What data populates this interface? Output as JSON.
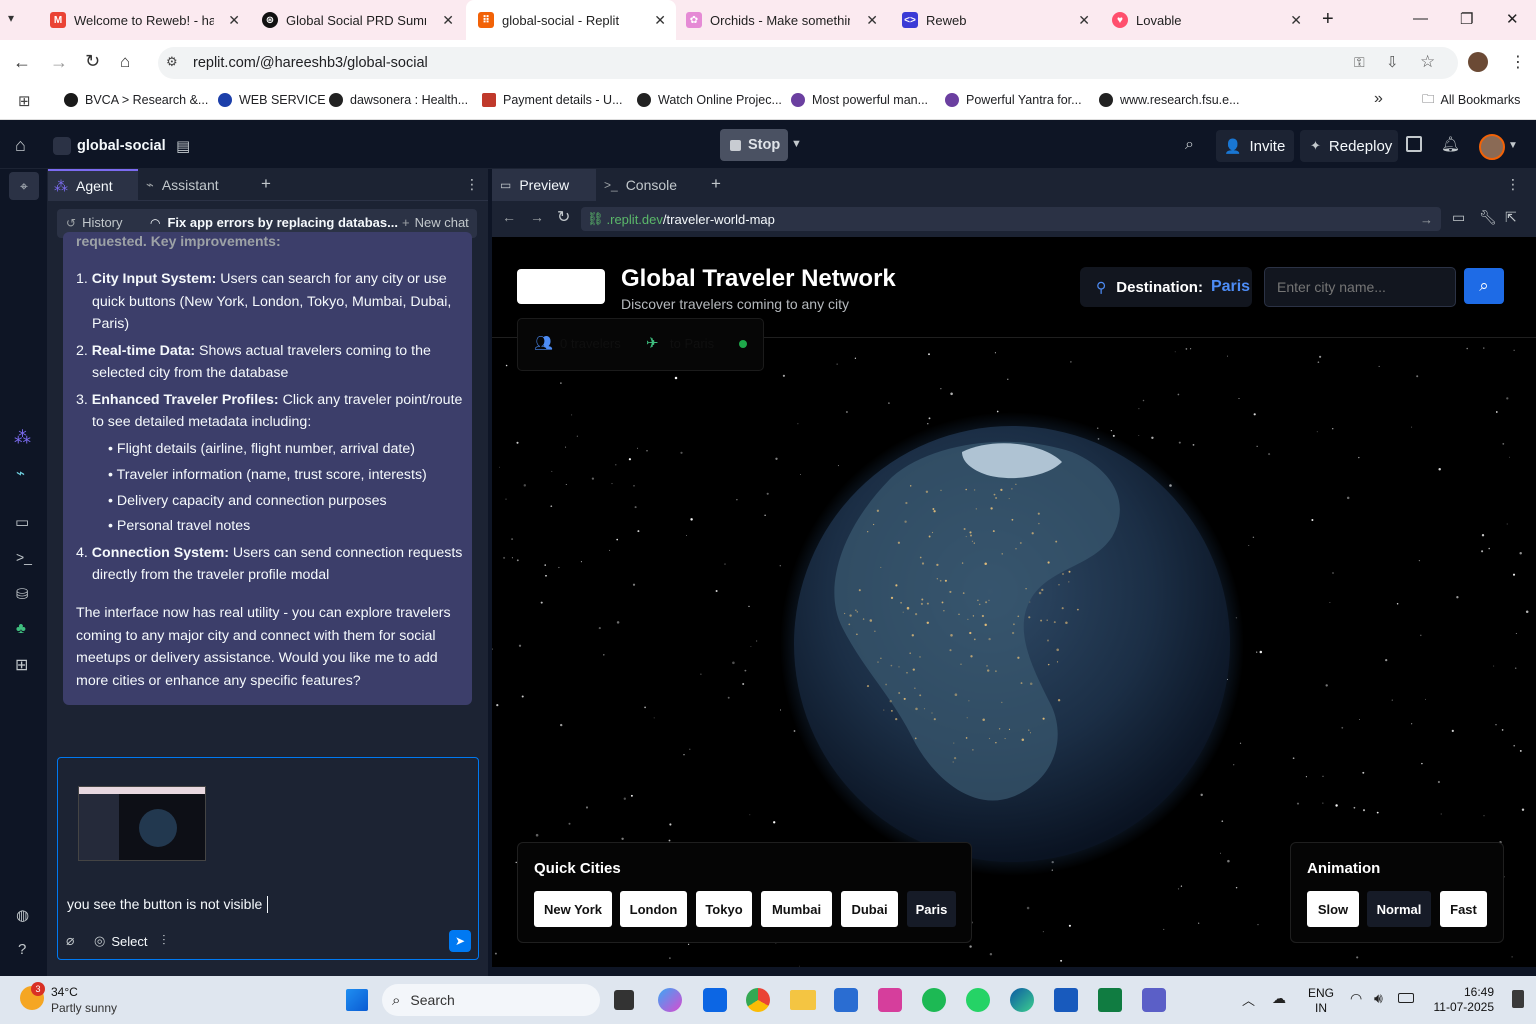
{
  "browser": {
    "tabs": [
      {
        "title": "Welcome to Reweb! - hare",
        "color": "#ea4335",
        "glyph": "M"
      },
      {
        "title": "Global Social PRD Summar",
        "color": "#111111",
        "glyph": "⊛"
      },
      {
        "title": "global-social - Replit",
        "color": "#f26207",
        "glyph": "⠿"
      },
      {
        "title": "Orchids - Make something",
        "color": "#e58ad5",
        "glyph": "✿"
      },
      {
        "title": "Reweb",
        "color": "#3b3bd6",
        "glyph": "<>"
      },
      {
        "title": "Lovable",
        "color": "#ff4f6d",
        "glyph": "♥"
      }
    ],
    "url": "replit.com/@hareeshb3/global-social",
    "bookmarks": [
      {
        "label": "BVCA > Research &...",
        "color": "#1a1a1a"
      },
      {
        "label": "WEB SERVICE",
        "color": "#1c3faa"
      },
      {
        "label": "dawsonera : Health...",
        "color": "#222222"
      },
      {
        "label": "Payment details - U...",
        "color": "#c0392b"
      },
      {
        "label": "Watch Online Projec...",
        "color": "#222222"
      },
      {
        "label": "Most powerful man...",
        "color": "#6b3fa0"
      },
      {
        "label": "Powerful Yantra for...",
        "color": "#6b3fa0"
      },
      {
        "label": "www.research.fsu.e...",
        "color": "#222222"
      }
    ],
    "all_bookmarks": "All Bookmarks"
  },
  "replit": {
    "project": "global-social",
    "stop": "Stop",
    "invite": "Invite",
    "redeploy": "Redeploy",
    "panel_tabs": {
      "agent": "Agent",
      "assistant": "Assistant"
    },
    "history": "History",
    "chat_title": "Fix app errors by replacing databas...",
    "new_chat": "New chat",
    "msg_cutoff": "requested. Key improvements:",
    "msg": {
      "i1_b": "City Input System:",
      "i1": " Users can search for any city or use quick buttons (New York, London, Tokyo, Mumbai, Dubai, Paris)",
      "i2_b": "Real-time Data:",
      "i2": " Shows actual travelers coming to the selected city from the database",
      "i3_b": "Enhanced Traveler Profiles:",
      "i3": " Click any traveler point/route to see detailed metadata including:",
      "sub1": "Flight details (airline, flight number, arrival date)",
      "sub2": "Traveler information (name, trust score, interests)",
      "sub3": "Delivery capacity and connection purposes",
      "sub4": "Personal travel notes",
      "i4_b": "Connection System:",
      "i4": " Users can send connection requests directly from the traveler profile modal",
      "closing": "The interface now has real utility - you can explore travelers coming to any major city and connect with them for social meetups or delivery assistance. Would you like me to add more cities or enhance any specific features?"
    },
    "input_text": "you see the button is not visible",
    "select": "Select",
    "preview_tab": "Preview",
    "console_tab": "Console",
    "preview_url_host": ".replit.dev",
    "preview_url_path": "/traveler-world-map"
  },
  "app": {
    "title": "Global Traveler Network",
    "subtitle": "Discover travelers coming to any city",
    "destination_label": "Destination:",
    "destination_value": "Paris",
    "city_placeholder": "Enter city name...",
    "stats_travelers": "0 travelers",
    "stats_to": "to Paris",
    "quick_cities_title": "Quick Cities",
    "cities": [
      "New York",
      "London",
      "Tokyo",
      "Mumbai",
      "Dubai",
      "Paris"
    ],
    "animation_title": "Animation",
    "speeds": [
      "Slow",
      "Normal",
      "Fast"
    ]
  },
  "taskbar": {
    "weather_temp": "34°C",
    "weather_text": "Partly sunny",
    "weather_badge": "3",
    "search": "Search",
    "lang1": "ENG",
    "lang2": "IN",
    "time": "16:49",
    "date": "11-07-2025"
  }
}
